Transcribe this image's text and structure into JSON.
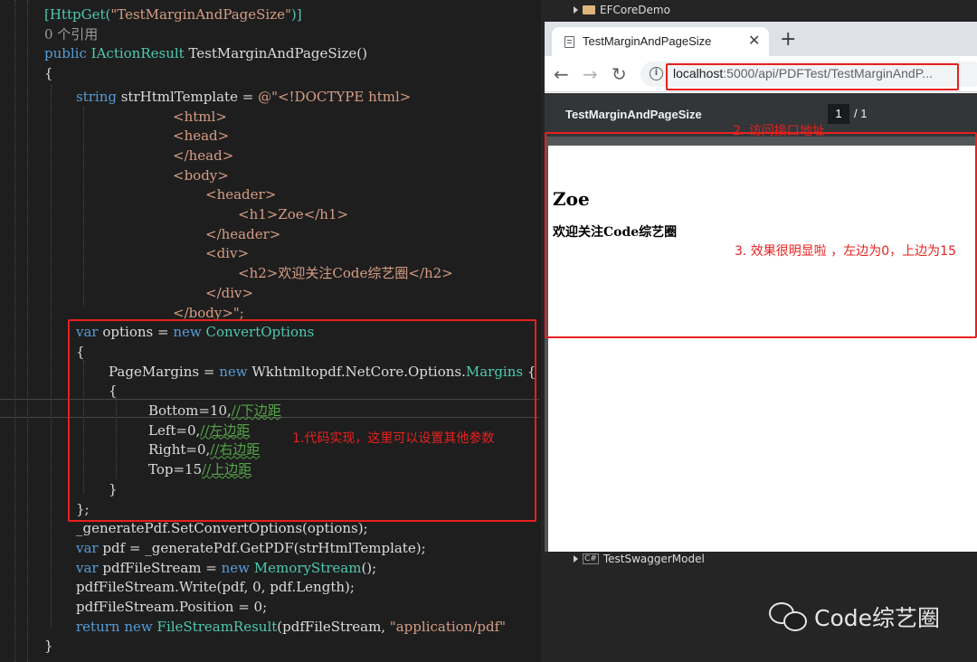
{
  "editor": {
    "lines": [
      {
        "parts": [
          [
            "at",
            "[HttpGet("
          ],
          [
            "st",
            "\"TestMarginAndPageSize\""
          ],
          [
            "at",
            ")]"
          ]
        ]
      },
      {
        "parts": [
          [
            "mu",
            "0 个引用"
          ]
        ]
      },
      {
        "parts": [
          [
            "kw",
            "public"
          ],
          [
            "",
            " "
          ],
          [
            "ty",
            "IActionResult"
          ],
          [
            "",
            " TestMarginAndPageSize()"
          ]
        ]
      },
      {
        "parts": [
          [
            "",
            "{"
          ]
        ]
      },
      {
        "parts": [
          [
            "kw",
            "string"
          ],
          [
            "",
            " strHtmlTemplate = "
          ],
          [
            "st",
            "@\"<!DOCTYPE html>"
          ]
        ]
      },
      {
        "parts": [
          [
            "st",
            "<html>"
          ]
        ]
      },
      {
        "parts": [
          [
            "st",
            "<head>"
          ]
        ]
      },
      {
        "parts": [
          [
            "st",
            "</head>"
          ]
        ]
      },
      {
        "parts": [
          [
            "st",
            "<body>"
          ]
        ]
      },
      {
        "parts": [
          [
            "st",
            "<header>"
          ]
        ]
      },
      {
        "parts": [
          [
            "st",
            "<h1>Zoe</h1>"
          ]
        ]
      },
      {
        "parts": [
          [
            "st",
            "</header>"
          ]
        ]
      },
      {
        "parts": [
          [
            "st",
            "<div>"
          ]
        ]
      },
      {
        "parts": [
          [
            "st",
            "<h2>欢迎关注Code综艺圈</h2>"
          ]
        ]
      },
      {
        "parts": [
          [
            "st",
            "</div>"
          ]
        ]
      },
      {
        "parts": [
          [
            "st",
            "</body>\";"
          ]
        ]
      },
      {
        "parts": [
          [
            "kw",
            "var"
          ],
          [
            "",
            " options = "
          ],
          [
            "kw",
            "new"
          ],
          [
            "",
            " "
          ],
          [
            "ty",
            "ConvertOptions"
          ]
        ]
      },
      {
        "parts": [
          [
            "",
            "{"
          ]
        ]
      },
      {
        "parts": [
          [
            "",
            "PageMargins = "
          ],
          [
            "kw",
            "new"
          ],
          [
            "",
            " Wkhtmltopdf.NetCore.Options."
          ],
          [
            "ty",
            "Margins"
          ],
          [
            "",
            " {"
          ]
        ]
      },
      {
        "parts": [
          [
            "",
            "{"
          ]
        ]
      },
      {
        "parts": [
          [
            "",
            "Bottom=10,"
          ],
          [
            "cm",
            "//下边距"
          ]
        ]
      },
      {
        "parts": [
          [
            "",
            "Left=0,"
          ],
          [
            "cm",
            "//左边距"
          ]
        ]
      },
      {
        "parts": [
          [
            "",
            "Right=0,"
          ],
          [
            "cm",
            "//右边距"
          ]
        ]
      },
      {
        "parts": [
          [
            "",
            "Top=15"
          ],
          [
            "cm",
            "//上边距"
          ]
        ]
      },
      {
        "parts": [
          [
            "",
            "}"
          ]
        ]
      },
      {
        "parts": [
          [
            "",
            "};"
          ]
        ]
      },
      {
        "parts": [
          [
            "",
            "_generatePdf.SetConvertOptions(options);"
          ]
        ]
      },
      {
        "parts": [
          [
            "kw",
            "var"
          ],
          [
            "",
            " pdf = _generatePdf.GetPDF(strHtmlTemplate);"
          ]
        ]
      },
      {
        "parts": [
          [
            "kw",
            "var"
          ],
          [
            "",
            " pdfFileStream = "
          ],
          [
            "kw",
            "new"
          ],
          [
            "",
            " "
          ],
          [
            "ty",
            "MemoryStream"
          ],
          [
            "",
            "();"
          ]
        ]
      },
      {
        "parts": [
          [
            "",
            "pdfFileStream.Write(pdf, 0, pdf.Length);"
          ]
        ]
      },
      {
        "parts": [
          [
            "",
            "pdfFileStream.Position = 0;"
          ]
        ]
      },
      {
        "parts": [
          [
            "kw",
            "return"
          ],
          [
            "",
            " "
          ],
          [
            "kw",
            "new"
          ],
          [
            "",
            " "
          ],
          [
            "ty",
            "FileStreamResult"
          ],
          [
            "",
            "(pdfFileStream, "
          ],
          [
            "st",
            "\"application/pdf\""
          ]
        ]
      },
      {
        "parts": [
          [
            "",
            "}"
          ]
        ]
      }
    ],
    "annotation": "1.代码实现，这里可以设置其他参数"
  },
  "solution": {
    "top_item": "EFCoreDemo",
    "bottom_item": "TestSwaggerModel",
    "bottom_badge": "C#"
  },
  "browser": {
    "tab_title": "TestMarginAndPageSize",
    "tab_close": "✕",
    "new_tab": "+",
    "back": "←",
    "forward": "→",
    "reload": "↻",
    "info": "i",
    "url_host": "localhost",
    "url_rest": ":5000/api/PDFTest/TestMarginAndP...",
    "pdf_title": "TestMarginAndPageSize",
    "pdf_page": "1",
    "pdf_total": "/  1",
    "annotation_url": "2. 访问接口地址",
    "pdf_h1": "Zoe",
    "pdf_h2": "欢迎关注Code综艺圈",
    "annotation_result": "3. 效果很明显啦 ，左边为0，上边为15"
  },
  "watermark": {
    "text": "Code综艺圈",
    "icon": "wechat-icon"
  },
  "colors": {
    "annotation_red": "#e8201e",
    "keyword": "#569cd6",
    "type": "#4ec9b0",
    "string": "#d69d85",
    "comment": "#57a64a"
  }
}
